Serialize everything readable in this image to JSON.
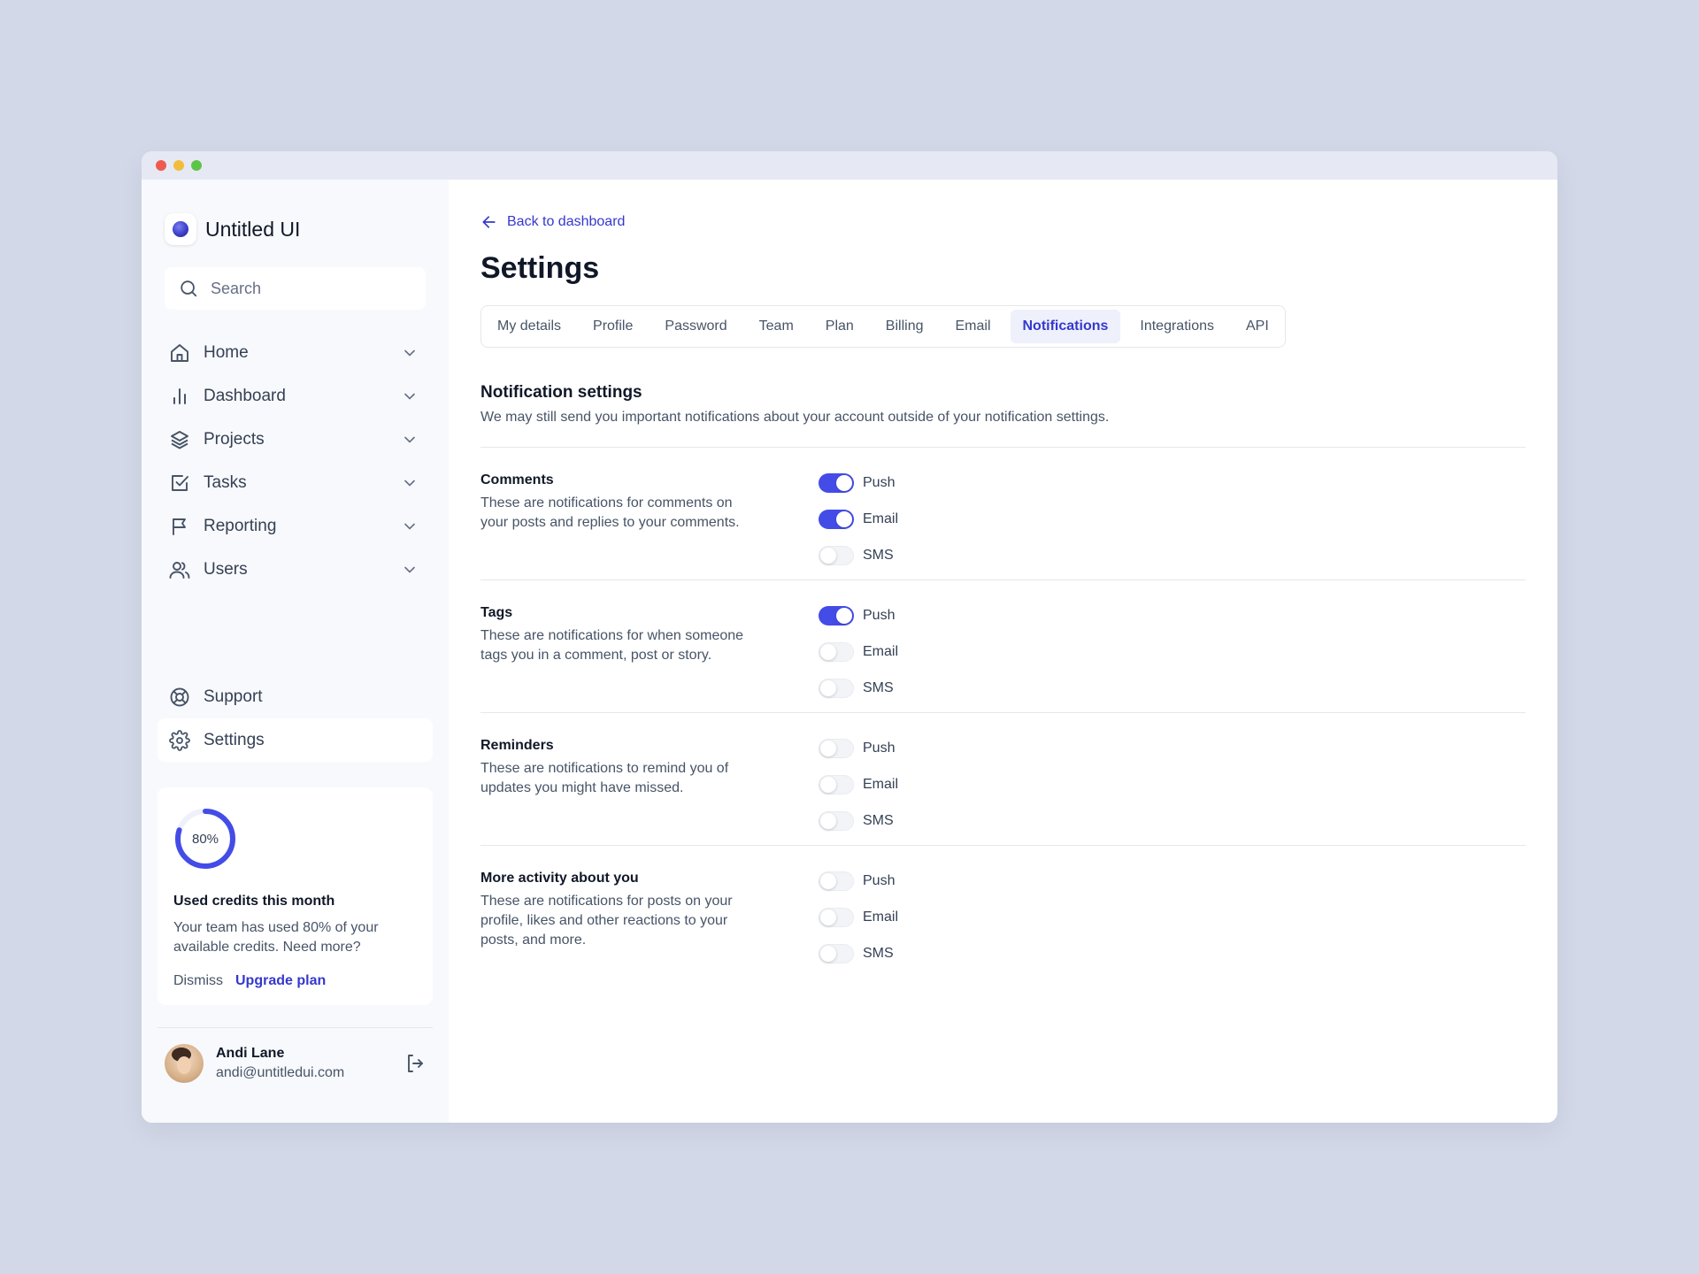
{
  "sidebar": {
    "brand": "Untitled UI",
    "search_placeholder": "Search",
    "nav": [
      {
        "label": "Home",
        "icon": "home-icon"
      },
      {
        "label": "Dashboard",
        "icon": "bar-chart-icon"
      },
      {
        "label": "Projects",
        "icon": "layers-icon"
      },
      {
        "label": "Tasks",
        "icon": "check-square-icon"
      },
      {
        "label": "Reporting",
        "icon": "flag-icon"
      },
      {
        "label": "Users",
        "icon": "users-icon"
      }
    ],
    "bottom_nav": [
      {
        "label": "Support",
        "icon": "life-buoy-icon"
      },
      {
        "label": "Settings",
        "icon": "gear-icon"
      }
    ],
    "credits": {
      "percent_label": "80%",
      "percent_value": 0.8,
      "title": "Used credits this month",
      "description": "Your team has used 80% of your available credits. Need more?",
      "dismiss": "Dismiss",
      "upgrade": "Upgrade plan"
    },
    "user": {
      "name": "Andi Lane",
      "email": "andi@untitledui.com"
    }
  },
  "main": {
    "back_label": "Back to dashboard",
    "title": "Settings",
    "tabs": [
      "My details",
      "Profile",
      "Password",
      "Team",
      "Plan",
      "Billing",
      "Email",
      "Notifications",
      "Integrations",
      "API"
    ],
    "active_tab": "Notifications",
    "section_title": "Notification settings",
    "section_subtitle": "We may still send you important notifications about your account outside of your notification settings.",
    "groups": [
      {
        "title": "Comments",
        "description": "These are notifications for comments on your posts and replies to your comments.",
        "toggles": [
          {
            "label": "Push",
            "on": true
          },
          {
            "label": "Email",
            "on": true
          },
          {
            "label": "SMS",
            "on": false
          }
        ]
      },
      {
        "title": "Tags",
        "description": "These are notifications for when someone tags you in a comment, post or story.",
        "toggles": [
          {
            "label": "Push",
            "on": true
          },
          {
            "label": "Email",
            "on": false
          },
          {
            "label": "SMS",
            "on": false
          }
        ]
      },
      {
        "title": "Reminders",
        "description": "These are notifications to remind you of updates you might have missed.",
        "toggles": [
          {
            "label": "Push",
            "on": false
          },
          {
            "label": "Email",
            "on": false
          },
          {
            "label": "SMS",
            "on": false
          }
        ]
      },
      {
        "title": "More activity about you",
        "description": "These are notifications for posts on your profile, likes and other reactions to your posts, and more.",
        "toggles": [
          {
            "label": "Push",
            "on": false
          },
          {
            "label": "Email",
            "on": false
          },
          {
            "label": "SMS",
            "on": false
          }
        ]
      }
    ]
  },
  "colors": {
    "accent": "#444ce7",
    "link": "#3538cd",
    "background": "#d2d8e7"
  }
}
